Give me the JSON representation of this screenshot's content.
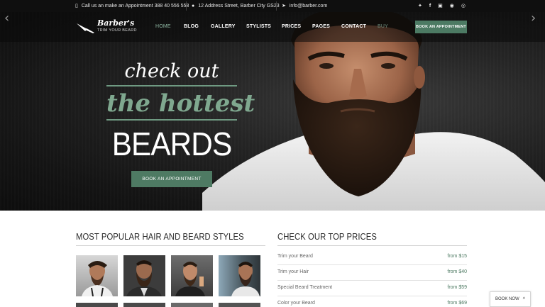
{
  "topbar": {
    "phone_text": "Call us an make an Appointment 388 40 556 558",
    "address_text": "12 Address Street, Barber City GS23",
    "email_text": "info@barber.com",
    "social_icons": [
      "twitter-icon",
      "facebook-icon",
      "instagram-icon",
      "pinterest-icon",
      "dribbble-icon"
    ]
  },
  "brand": {
    "name": "Barber's",
    "tagline": "TRIM YOUR BEARD"
  },
  "nav": {
    "items": [
      "HOME",
      "BLOG",
      "GALLERY",
      "STYLISTS",
      "PRICES",
      "PAGES",
      "CONTACT",
      "BUY"
    ],
    "active": "HOME",
    "book_button": "BOOK AN APPOINTMENT"
  },
  "hero": {
    "line1": "check out",
    "line2": "the hottest",
    "line3": "BEARDS",
    "cta": "BOOK AN APPOINTMENT",
    "prev_arrow": "‹",
    "next_arrow": "›"
  },
  "styles_section": {
    "title": "MOST POPULAR HAIR AND BEARD STYLES"
  },
  "prices_section": {
    "title": "CHECK OUR TOP PRICES",
    "rows": [
      {
        "service": "Trim your Beard",
        "price": "from $15"
      },
      {
        "service": "Trim your Hair",
        "price": "from $40"
      },
      {
        "service": "Special Beard Treatment",
        "price": "from $59"
      },
      {
        "service": "Color your Beard",
        "price": "from $69"
      }
    ]
  },
  "book_now": {
    "label": "BOOK NOW"
  },
  "colors": {
    "accent": "#4e7a63",
    "accent_light": "#7fa88f",
    "topbar_bg": "#0f0f0f"
  }
}
